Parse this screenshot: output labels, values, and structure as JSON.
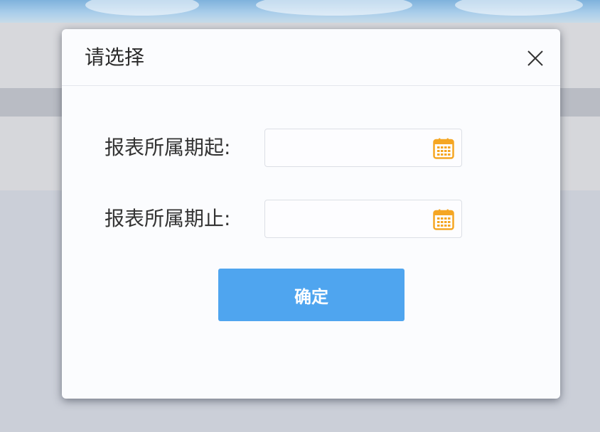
{
  "dialog": {
    "title": "请选择",
    "close_icon": "close-icon"
  },
  "form": {
    "start_label": "报表所属期起:",
    "start_value": "",
    "end_label": "报表所属期止:",
    "end_value": "",
    "calendar_icon": "calendar-icon"
  },
  "actions": {
    "confirm_label": "确定"
  },
  "colors": {
    "primary_button": "#4fa5ef",
    "calendar_icon": "#f5a623",
    "dialog_background": "#fbfcfe",
    "overlay": "#ccd0d9"
  }
}
